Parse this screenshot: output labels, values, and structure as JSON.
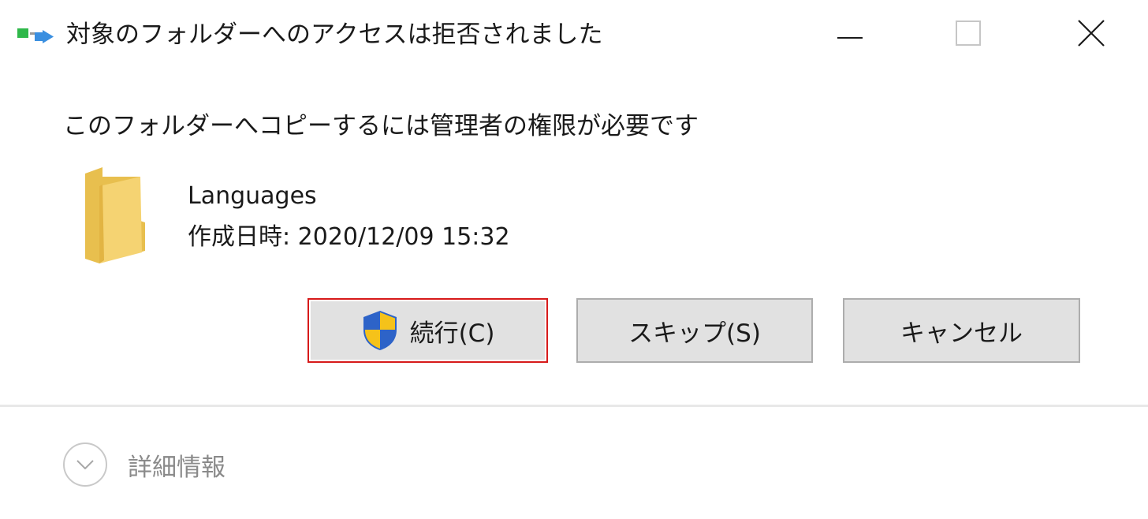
{
  "window": {
    "title": "対象のフォルダーへのアクセスは拒否されました",
    "minimize_icon": "minimize-icon",
    "maximize_icon": "maximize-icon",
    "close_icon": "close-icon"
  },
  "dialog": {
    "message": "このフォルダーへコピーするには管理者の権限が必要です",
    "item": {
      "icon": "folder-icon",
      "name": "Languages",
      "date_label": "作成日時:",
      "date_value": "2020/12/09 15:32"
    },
    "buttons": {
      "continue_label": "続行(C)",
      "skip_label": "スキップ(S)",
      "cancel_label": "キャンセル"
    },
    "details_label": "詳細情報"
  },
  "colors": {
    "focus_border": "#d71a1a",
    "button_bg": "#e1e1e1",
    "folder": "#f5d372"
  }
}
